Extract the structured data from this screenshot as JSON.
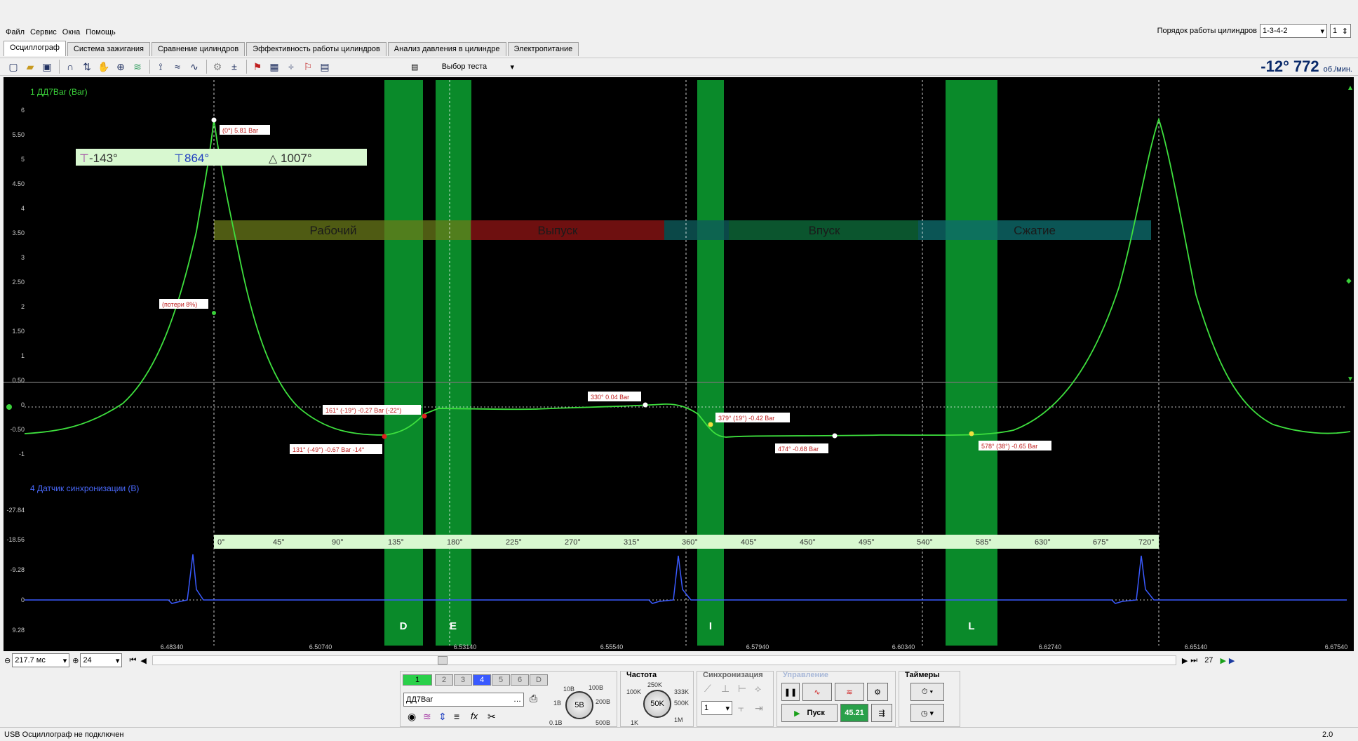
{
  "menu": [
    "Файл",
    "Сервис",
    "Окна",
    "Помощь"
  ],
  "cylinder_order": {
    "label": "Порядок работы цилиндров",
    "value": "1-3-4-2",
    "index": "1"
  },
  "tabs": [
    "Осциллограф",
    "Система зажигания",
    "Сравнение цилиндров",
    "Эффективность работы цилиндров",
    "Анализ давления в цилиндре",
    "Электропитание"
  ],
  "test_select": "Выбор теста",
  "rpm": {
    "angle": "-12°",
    "value": "772",
    "unit": "об./мин."
  },
  "channel1": {
    "name": "1 ДД7Bar (Bar)",
    "y_ticks": [
      "6",
      "5.50",
      "5",
      "4.50",
      "4",
      "3.50",
      "3",
      "2.50",
      "2",
      "1.50",
      "1",
      "0.50",
      "0",
      "-0.50",
      "-1"
    ],
    "markers": {
      "m1": "-143°",
      "m2": "864°",
      "delta": "1007°"
    },
    "phases": [
      "Рабочий",
      "Выпуск",
      "Впуск",
      "Сжатие"
    ],
    "annotations": [
      "(0°) 5.81 Bar",
      "(потери 8%)",
      "161° (-19°) -0.27 Bar (-22°)",
      "131° (-49°) -0.67 Bar -14°",
      "330° 0.04 Bar",
      "379° (19°) -0.42 Bar",
      "474° -0.68 Bar",
      "578° (38°) -0.65 Bar"
    ]
  },
  "channel4": {
    "name": "4 Датчик синхронизации (В)",
    "y_ticks": [
      "-27.84",
      "-18.56",
      "-9.28",
      "0",
      "9.28"
    ],
    "zones": [
      "D",
      "E",
      "I",
      "L"
    ]
  },
  "degree_ruler": [
    "0°",
    "45°",
    "90°",
    "135°",
    "180°",
    "225°",
    "270°",
    "315°",
    "360°",
    "405°",
    "450°",
    "495°",
    "540°",
    "585°",
    "630°",
    "675°",
    "720°"
  ],
  "time_ticks": [
    "6.48340",
    "6.50740",
    "6.53140",
    "6.55540",
    "6.57940",
    "6.60340",
    "6.62740",
    "6.65140",
    "6.67540"
  ],
  "nav": {
    "timebase": "217.7 мс",
    "zoom": "24",
    "page": "27"
  },
  "channels_panel": {
    "buttons": [
      "1",
      "2",
      "3",
      "4",
      "5",
      "6",
      "D"
    ],
    "sensor": "ДД7Bar",
    "volt_scale": "5В",
    "volt_ticks": [
      "10В",
      "100В",
      "1В",
      "200В",
      "0.1В",
      "500В"
    ]
  },
  "freq_panel": {
    "title": "Частота",
    "value": "50K",
    "ticks": [
      "250K",
      "100K",
      "333K",
      "500K",
      "1K",
      "1M"
    ]
  },
  "sync_panel": {
    "title": "Синхронизация",
    "value": "1"
  },
  "control_panel": {
    "title": "Управление",
    "start": "Пуск",
    "fps": "45.21"
  },
  "timers_panel": {
    "title": "Таймеры"
  },
  "status": {
    "text": "USB Осциллограф не подключен",
    "version": "2.0"
  }
}
